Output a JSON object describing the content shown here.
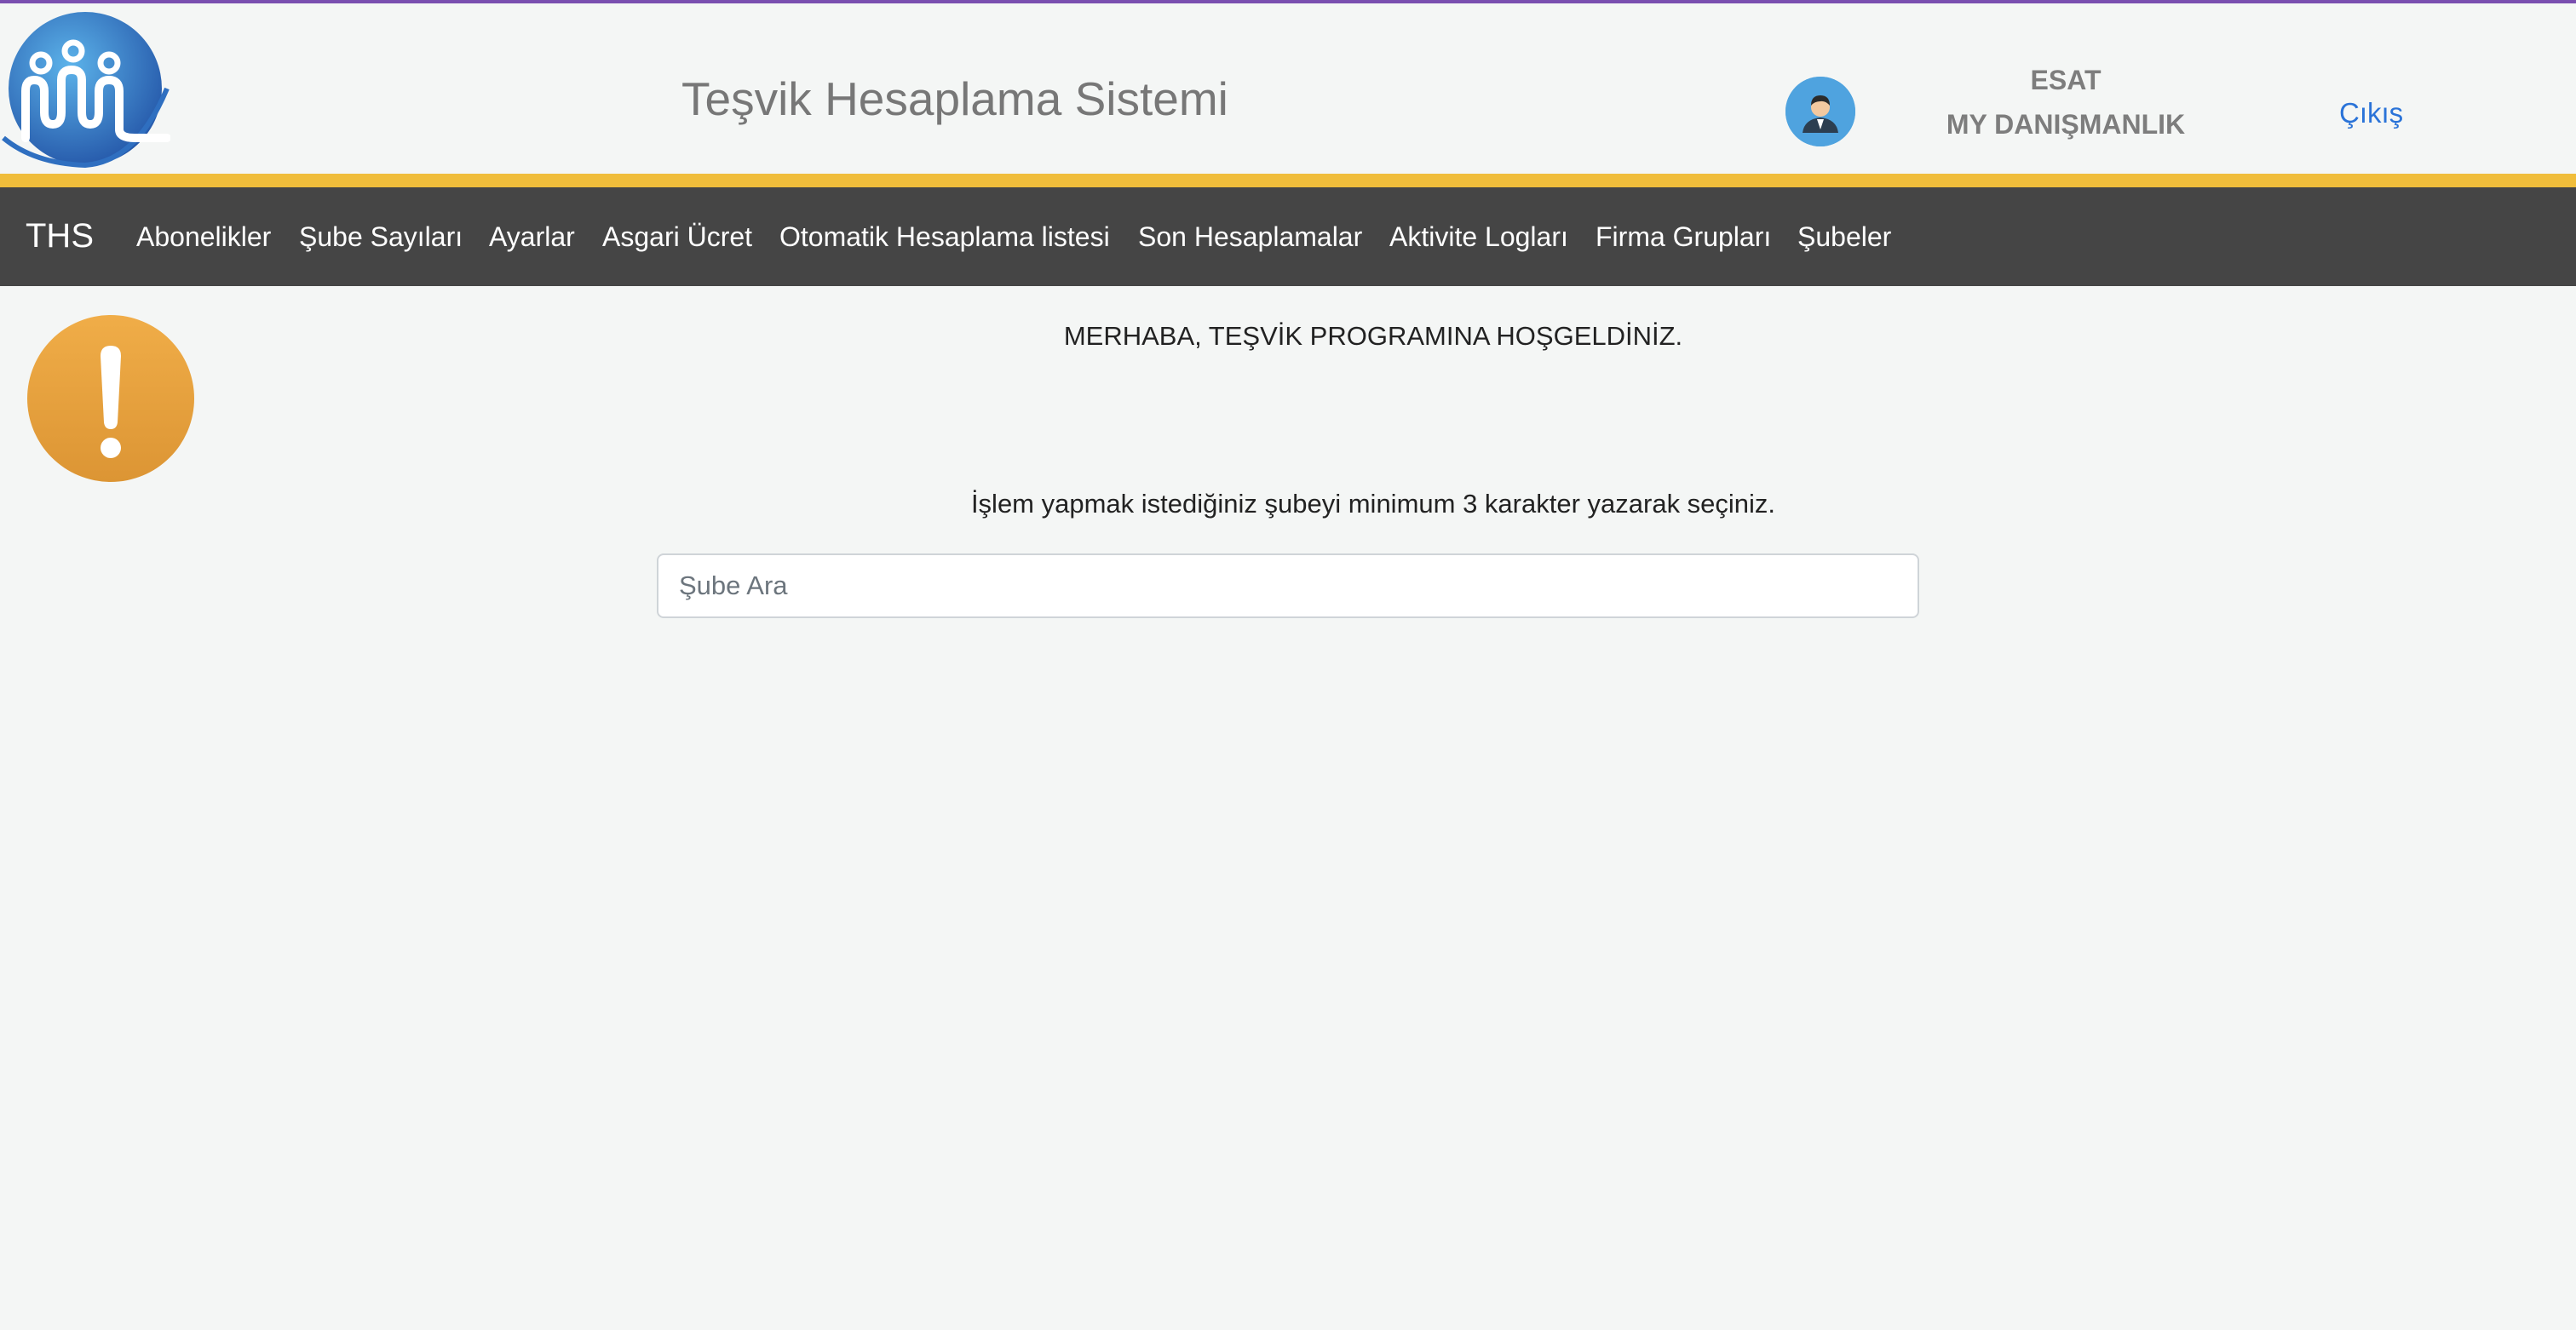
{
  "colors": {
    "top_line": "#7a4fb0",
    "accent_bar": "#f0bd3b",
    "navbar_bg": "#454545",
    "link": "#2a73d8",
    "alert_icon": "#e9a63d"
  },
  "header": {
    "logo_icon": "people-globe-logo",
    "app_title": "Teşvik Hesaplama Sistemi",
    "user": {
      "avatar_icon": "user-avatar-icon",
      "name": "ESAT",
      "company": "MY DANIŞMANLIK"
    },
    "logout_label": "Çıkış"
  },
  "navbar": {
    "brand": "THS",
    "items": [
      {
        "label": "Abonelikler"
      },
      {
        "label": "Şube Sayıları"
      },
      {
        "label": "Ayarlar"
      },
      {
        "label": "Asgari Ücret"
      },
      {
        "label": "Otomatik Hesaplama listesi"
      },
      {
        "label": "Son Hesaplamalar"
      },
      {
        "label": "Aktivite Logları"
      },
      {
        "label": "Firma Grupları"
      },
      {
        "label": "Şubeler"
      }
    ]
  },
  "main": {
    "alert_icon": "exclamation-icon",
    "welcome_text": "MERHABA, TEŞVİK PROGRAMINA HOŞGELDİNİZ.",
    "instruction_text": "İşlem yapmak istediğiniz şubeyi minimum 3 karakter yazarak seçiniz.",
    "search": {
      "placeholder": "Şube Ara",
      "value": ""
    }
  }
}
